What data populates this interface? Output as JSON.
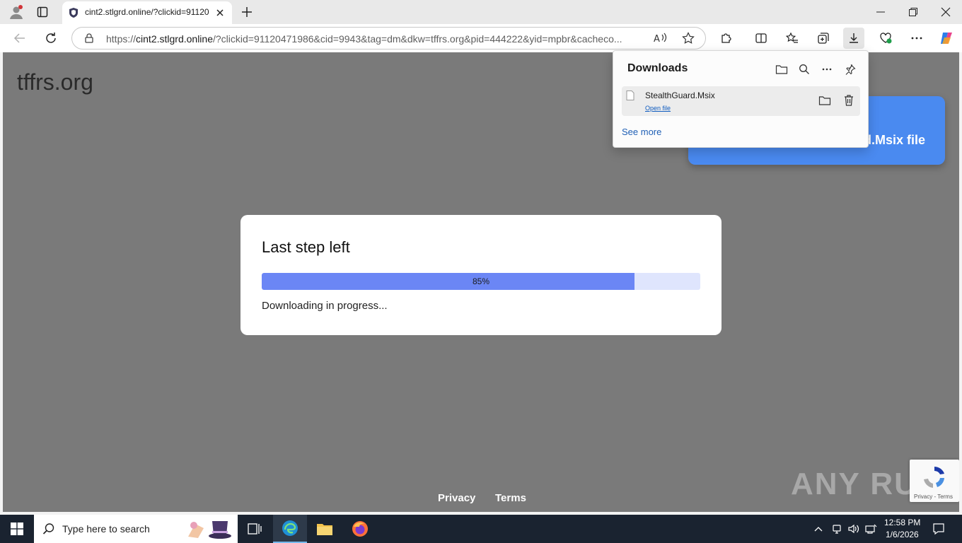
{
  "browser": {
    "tab_title": "cint2.stlgrd.online/?clickid=91120",
    "url_scheme": "https://",
    "url_host": "cint2.stlgrd.online",
    "url_path": "/?clickid=91120471986&cid=9943&tag=dm&dkw=tffrs.org&pid=444222&yid=mpbr&cacheco..."
  },
  "page": {
    "site_name": "tffrs.org",
    "card_text": "d.Msix file",
    "modal": {
      "title": "Last step left",
      "progress_percent": 85,
      "progress_label": "85%",
      "status": "Downloading in progress..."
    },
    "footer": {
      "privacy": "Privacy",
      "terms": "Terms"
    },
    "watermark": "ANY RUN",
    "recaptcha_links": "Privacy - Terms"
  },
  "downloads": {
    "title": "Downloads",
    "file_name": "StealthGuard.Msix",
    "open_file": "Open file",
    "see_more": "See more"
  },
  "taskbar": {
    "search_placeholder": "Type here to search",
    "time": "12:58 PM",
    "date": "1/6/2026"
  },
  "colors": {
    "progress_fill": "#6b86f5",
    "progress_track": "#dfe5fd",
    "card_blue": "#4a8af0",
    "overlay": "#7a7a7a"
  }
}
